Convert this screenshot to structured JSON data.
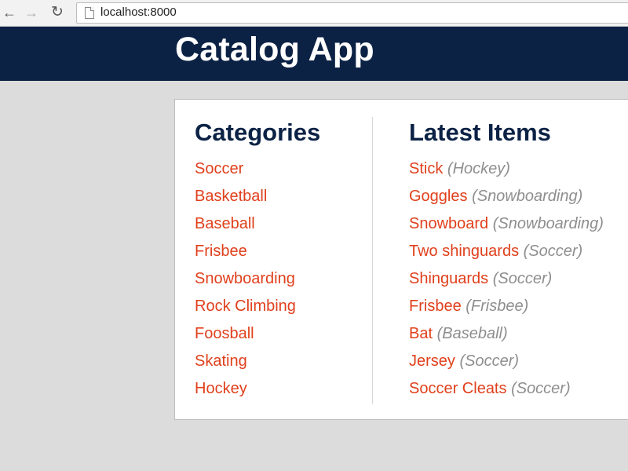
{
  "browser": {
    "url": "localhost:8000",
    "back_icon": "←",
    "forward_icon": "→",
    "reload_icon": "↻"
  },
  "header": {
    "title": "Catalog App",
    "color": "#0b2245"
  },
  "categories": {
    "title": "Categories",
    "items": [
      "Soccer",
      "Basketball",
      "Baseball",
      "Frisbee",
      "Snowboarding",
      "Rock Climbing",
      "Foosball",
      "Skating",
      "Hockey"
    ]
  },
  "latest": {
    "title": "Latest Items",
    "items": [
      {
        "name": "Stick",
        "category": "(Hockey)"
      },
      {
        "name": "Goggles",
        "category": "(Snowboarding)"
      },
      {
        "name": "Snowboard",
        "category": "(Snowboarding)"
      },
      {
        "name": "Two shinguards",
        "category": "(Soccer)"
      },
      {
        "name": "Shinguards",
        "category": "(Soccer)"
      },
      {
        "name": "Frisbee",
        "category": "(Frisbee)"
      },
      {
        "name": "Bat",
        "category": "(Baseball)"
      },
      {
        "name": "Jersey",
        "category": "(Soccer)"
      },
      {
        "name": "Soccer Cleats",
        "category": "(Soccer)"
      }
    ]
  },
  "colors": {
    "link": "#e0401c",
    "category_text": "#8e8e8e",
    "background": "#dcdcdc"
  }
}
